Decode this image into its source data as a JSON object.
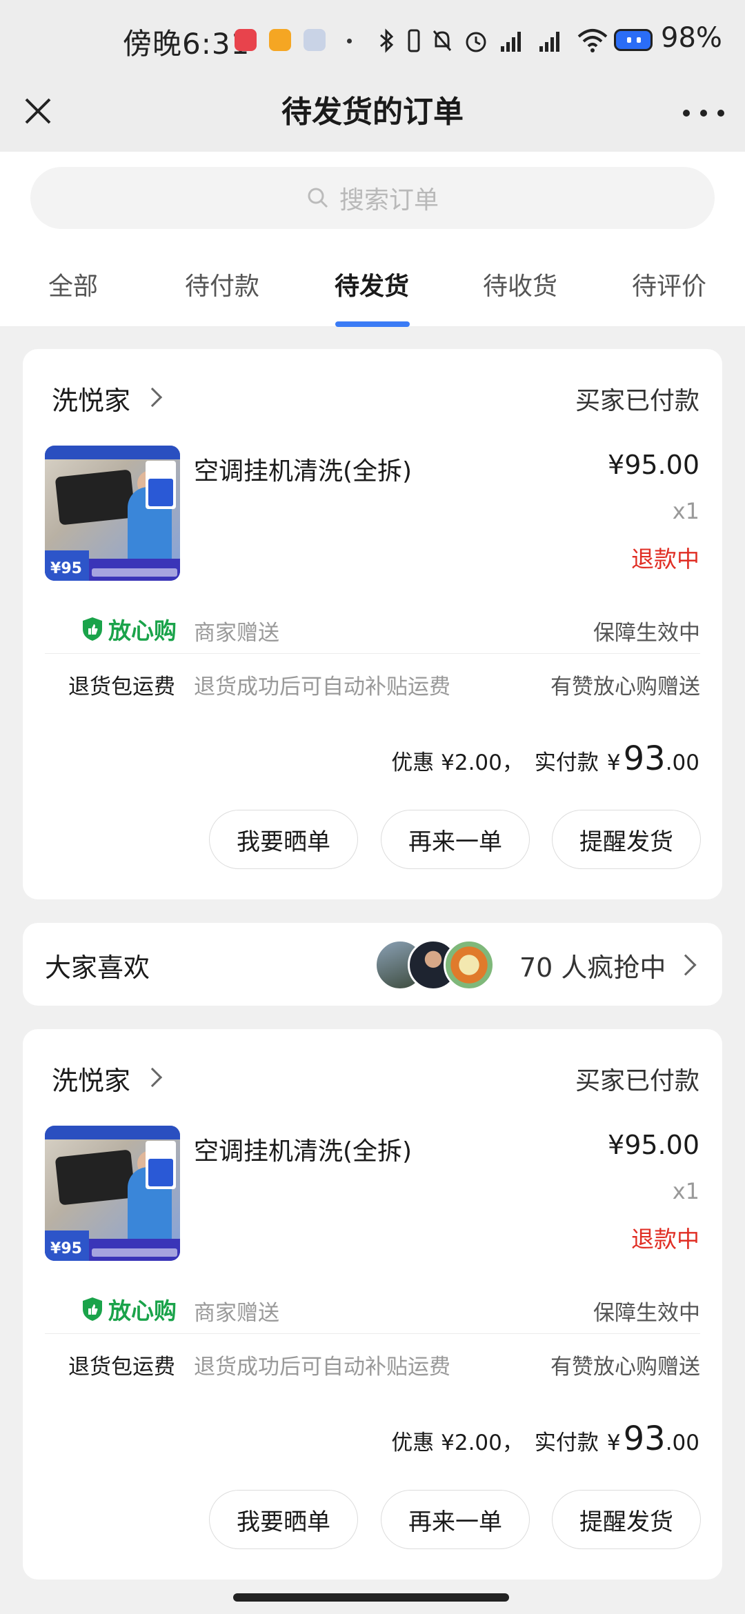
{
  "status_bar": {
    "time": "傍晚6:31",
    "battery_pct": "98%",
    "icons": [
      "app-netease-music-icon",
      "app-ai-icon",
      "app-rocket-icon",
      "bluetooth-icon",
      "vibrate-icon",
      "mute-icon",
      "alarm-icon",
      "signal-icon",
      "signal-icon",
      "wifi-icon",
      "battery-icon"
    ]
  },
  "nav": {
    "title": "待发货的订单",
    "close_icon": "close-icon",
    "more_icon": "more-icon"
  },
  "search": {
    "placeholder": "搜索订单"
  },
  "tabs": [
    {
      "label": "全部",
      "active": false
    },
    {
      "label": "待付款",
      "active": false
    },
    {
      "label": "待发货",
      "active": true
    },
    {
      "label": "待收货",
      "active": false
    },
    {
      "label": "待评价",
      "active": false
    }
  ],
  "thumbnail_price": "95",
  "orders": [
    {
      "shop": "洗悦家",
      "status": "买家已付款",
      "product_title": "空调挂机清洗(全拆)",
      "price": "¥95.00",
      "qty": "x1",
      "refund_status": "退款中",
      "assurance": {
        "name": "放心购",
        "desc": "商家赠送",
        "status": "保障生效中"
      },
      "shipping": {
        "label": "退货包运费",
        "desc": "退货成功后可自动补贴运费",
        "gift": "有赞放心购赠送"
      },
      "payment": {
        "discount": "优惠 ¥2.00，",
        "label": "实付款",
        "currency": "¥",
        "int": "93",
        "dec": ".00"
      },
      "buttons": [
        "我要晒单",
        "再来一单",
        "提醒发货"
      ]
    },
    {
      "shop": "洗悦家",
      "status": "买家已付款",
      "product_title": "空调挂机清洗(全拆)",
      "price": "¥95.00",
      "qty": "x1",
      "refund_status": "退款中",
      "assurance": {
        "name": "放心购",
        "desc": "商家赠送",
        "status": "保障生效中"
      },
      "shipping": {
        "label": "退货包运费",
        "desc": "退货成功后可自动补贴运费",
        "gift": "有赞放心购赠送"
      },
      "payment": {
        "discount": "优惠 ¥2.00，",
        "label": "实付款",
        "currency": "¥",
        "int": "93",
        "dec": ".00"
      },
      "buttons": [
        "我要晒单",
        "再来一单",
        "提醒发货"
      ]
    }
  ],
  "recommend": {
    "label": "大家喜欢",
    "count_text": "70 人疯抢中"
  },
  "colors": {
    "accent": "#3a7bf5",
    "refund": "#e02e24",
    "assurance": "#1aa34a"
  }
}
